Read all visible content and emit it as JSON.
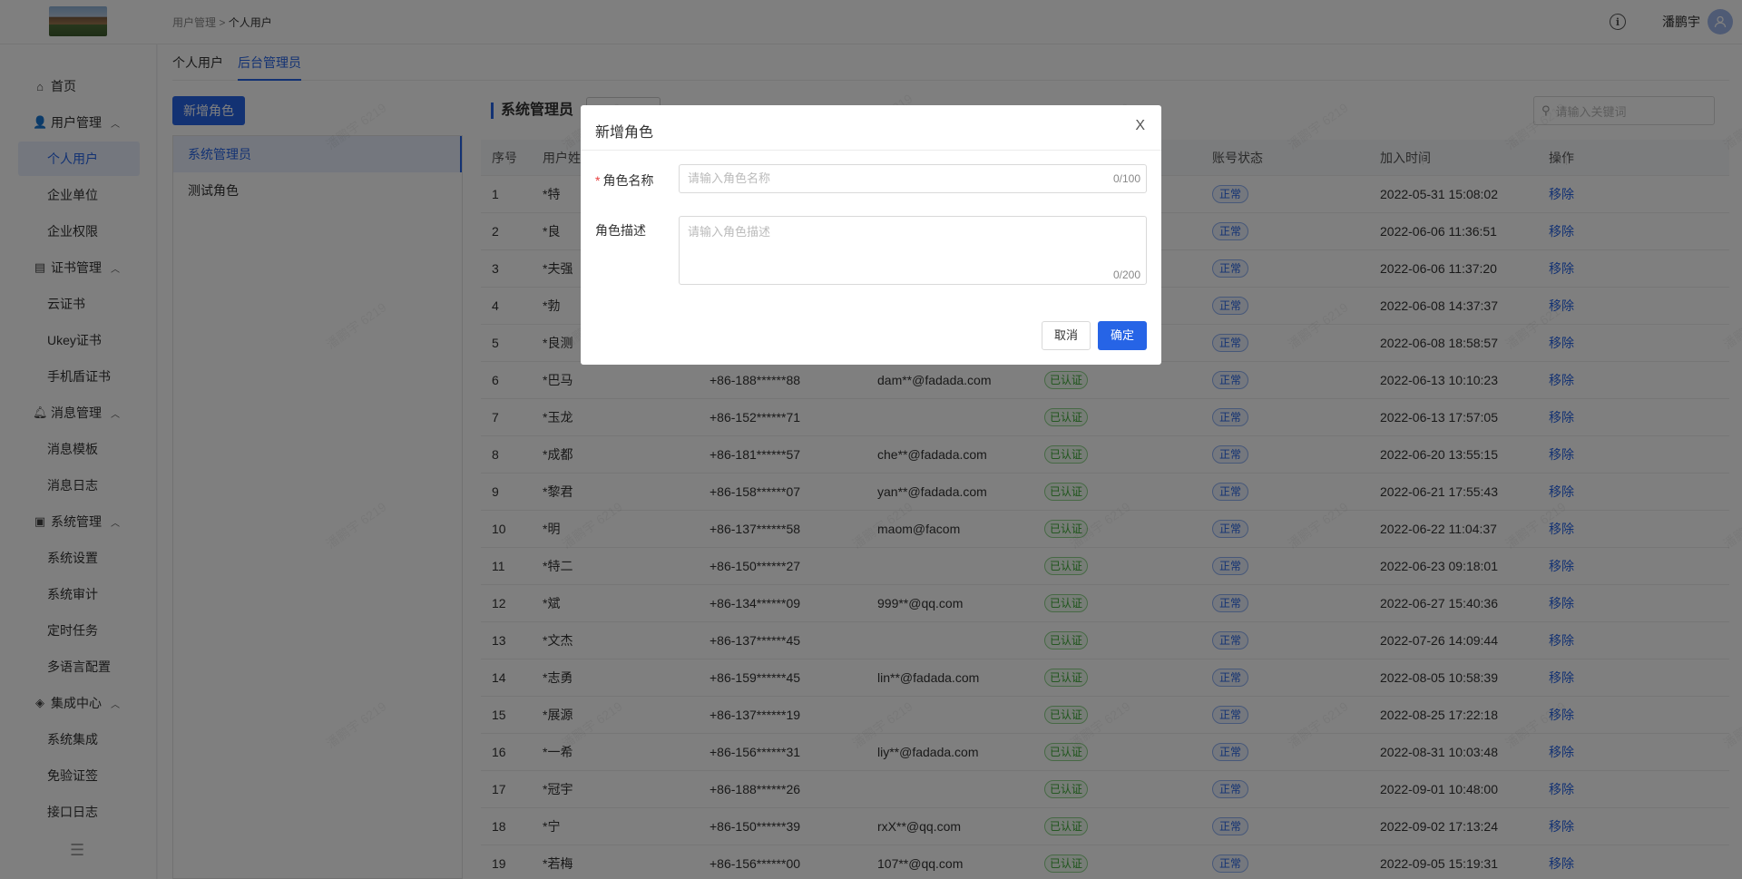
{
  "header": {
    "breadcrumb_parent": "用户管理",
    "breadcrumb_sep": ">",
    "breadcrumb_current": "个人用户",
    "info_glyph": "i",
    "username": "潘鹏宇"
  },
  "sidebar": {
    "home": "首页",
    "groups": {
      "user": "用户管理",
      "cert": "证书管理",
      "msg": "消息管理",
      "sys": "系统管理",
      "integ": "集成中心"
    },
    "items": {
      "personal": "个人用户",
      "enterprise": "企业单位",
      "ent_perm": "企业权限",
      "cloud_cert": "云证书",
      "ukey_cert": "Ukey证书",
      "shield_cert": "手机盾证书",
      "msg_tpl": "消息模板",
      "msg_log": "消息日志",
      "sys_setting": "系统设置",
      "sys_audit": "系统审计",
      "cron": "定时任务",
      "i18n": "多语言配置",
      "sys_integ": "系统集成",
      "no_verify": "免验证签",
      "api_log": "接口日志"
    }
  },
  "tabs": [
    "个人用户",
    "后台管理员"
  ],
  "add_role_button": "新增角色",
  "roles": [
    "系统管理员",
    "测试角色"
  ],
  "section_title": "系统管理员",
  "search_placeholder": "请输入关键词",
  "table": {
    "headers": [
      "序号",
      "用户姓名",
      "账号状态",
      "加入时间",
      "操作"
    ],
    "rows": [
      {
        "idx": "1",
        "name": "*特",
        "phone": "",
        "email": "",
        "auth": "",
        "status": "正常",
        "time": "2022-05-31 15:08:02",
        "op": "移除"
      },
      {
        "idx": "2",
        "name": "*良",
        "phone": "",
        "email": "",
        "auth": "",
        "status": "正常",
        "time": "2022-06-06 11:36:51",
        "op": "移除"
      },
      {
        "idx": "3",
        "name": "*夫强",
        "phone": "",
        "email": "",
        "auth": "",
        "status": "正常",
        "time": "2022-06-06 11:37:20",
        "op": "移除"
      },
      {
        "idx": "4",
        "name": "*勃",
        "phone": "",
        "email": "",
        "auth": "",
        "status": "正常",
        "time": "2022-06-08 14:37:37",
        "op": "移除"
      },
      {
        "idx": "5",
        "name": "*良测",
        "phone": "",
        "email": "",
        "auth": "",
        "status": "正常",
        "time": "2022-06-08 18:58:57",
        "op": "移除"
      },
      {
        "idx": "6",
        "name": "*巴马",
        "phone": "+86-188******88",
        "email": "dam**@fadada.com",
        "auth": "已认证",
        "status": "正常",
        "time": "2022-06-13 10:10:23",
        "op": "移除"
      },
      {
        "idx": "7",
        "name": "*玉龙",
        "phone": "+86-152******71",
        "email": "",
        "auth": "已认证",
        "status": "正常",
        "time": "2022-06-13 17:57:05",
        "op": "移除"
      },
      {
        "idx": "8",
        "name": "*成都",
        "phone": "+86-181******57",
        "email": "che**@fadada.com",
        "auth": "已认证",
        "status": "正常",
        "time": "2022-06-20 13:55:15",
        "op": "移除"
      },
      {
        "idx": "9",
        "name": "*黎君",
        "phone": "+86-158******07",
        "email": "yan**@fadada.com",
        "auth": "已认证",
        "status": "正常",
        "time": "2022-06-21 17:55:43",
        "op": "移除"
      },
      {
        "idx": "10",
        "name": "*明",
        "phone": "+86-137******58",
        "email": "maom@facom",
        "auth": "已认证",
        "status": "正常",
        "time": "2022-06-22 11:04:37",
        "op": "移除"
      },
      {
        "idx": "11",
        "name": "*特二",
        "phone": "+86-150******27",
        "email": "",
        "auth": "已认证",
        "status": "正常",
        "time": "2022-06-23 09:18:01",
        "op": "移除"
      },
      {
        "idx": "12",
        "name": "*斌",
        "phone": "+86-134******09",
        "email": "999**@qq.com",
        "auth": "已认证",
        "status": "正常",
        "time": "2022-06-27 15:40:36",
        "op": "移除"
      },
      {
        "idx": "13",
        "name": "*文杰",
        "phone": "+86-137******45",
        "email": "",
        "auth": "已认证",
        "status": "正常",
        "time": "2022-07-26 14:09:44",
        "op": "移除"
      },
      {
        "idx": "14",
        "name": "*志勇",
        "phone": "+86-159******45",
        "email": "lin**@fadada.com",
        "auth": "已认证",
        "status": "正常",
        "time": "2022-08-05 10:58:39",
        "op": "移除"
      },
      {
        "idx": "15",
        "name": "*展源",
        "phone": "+86-137******19",
        "email": "",
        "auth": "已认证",
        "status": "正常",
        "time": "2022-08-25 17:22:18",
        "op": "移除"
      },
      {
        "idx": "16",
        "name": "*一希",
        "phone": "+86-156******31",
        "email": "liy**@fadada.com",
        "auth": "已认证",
        "status": "正常",
        "time": "2022-08-31 10:03:48",
        "op": "移除"
      },
      {
        "idx": "17",
        "name": "*冠宇",
        "phone": "+86-188******26",
        "email": "",
        "auth": "已认证",
        "status": "正常",
        "time": "2022-09-01 10:48:00",
        "op": "移除"
      },
      {
        "idx": "18",
        "name": "*宁",
        "phone": "+86-150******39",
        "email": "rxX**@qq.com",
        "auth": "已认证",
        "status": "正常",
        "time": "2022-09-02 17:13:24",
        "op": "移除"
      },
      {
        "idx": "19",
        "name": "*若梅",
        "phone": "+86-156******00",
        "email": "107**@qq.com",
        "auth": "已认证",
        "status": "正常",
        "time": "2022-09-05 15:19:31",
        "op": "移除"
      }
    ]
  },
  "watermark": "潘鹏宇 6219",
  "modal": {
    "title": "新增角色",
    "close": "X",
    "name_label": "角色名称",
    "required_mark": "*",
    "name_placeholder": "请输入角色名称",
    "name_counter": "0/100",
    "desc_label": "角色描述",
    "desc_placeholder": "请输入角色描述",
    "desc_counter": "0/200",
    "cancel": "取消",
    "confirm": "确定"
  },
  "colors": {
    "primary": "#2664e6",
    "success": "#3aa935",
    "overlay": "rgba(0,0,0,0.5)"
  }
}
